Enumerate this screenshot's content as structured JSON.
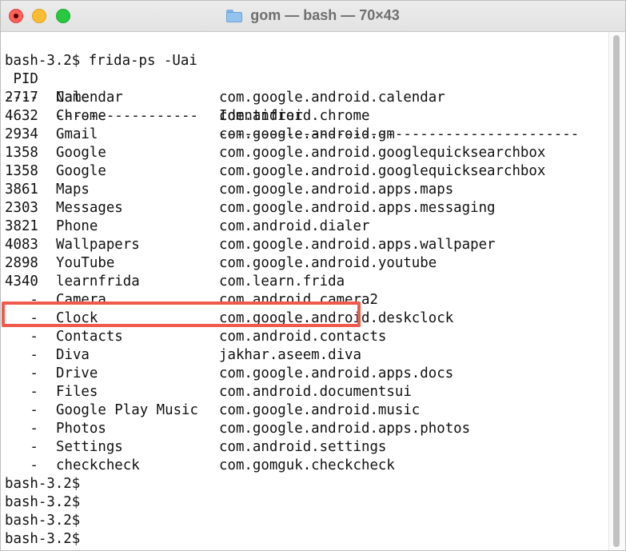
{
  "window": {
    "title": "gom — bash — 70×43",
    "folder_icon": "folder-icon"
  },
  "terminal": {
    "command_line": "bash-3.2$ frida-ps -Uai",
    "header": {
      "pid": " PID",
      "name": "Name",
      "identifier": "Identifier"
    },
    "separator": {
      "pid": "----",
      "name": "-----------------",
      "identifier": "-------------------------------------------"
    },
    "processes": [
      {
        "pid": "2717",
        "name": "Calendar",
        "identifier": "com.google.android.calendar"
      },
      {
        "pid": "4632",
        "name": "Chrome",
        "identifier": "com.android.chrome"
      },
      {
        "pid": "2934",
        "name": "Gmail",
        "identifier": "com.google.android.gm"
      },
      {
        "pid": "1358",
        "name": "Google",
        "identifier": "com.google.android.googlequicksearchbox"
      },
      {
        "pid": "1358",
        "name": "Google",
        "identifier": "com.google.android.googlequicksearchbox"
      },
      {
        "pid": "3861",
        "name": "Maps",
        "identifier": "com.google.android.apps.maps"
      },
      {
        "pid": "2303",
        "name": "Messages",
        "identifier": "com.google.android.apps.messaging"
      },
      {
        "pid": "3821",
        "name": "Phone",
        "identifier": "com.android.dialer"
      },
      {
        "pid": "4083",
        "name": "Wallpapers",
        "identifier": "com.google.android.apps.wallpaper"
      },
      {
        "pid": "2898",
        "name": "YouTube",
        "identifier": "com.google.android.youtube"
      },
      {
        "pid": "4340",
        "name": "learnfrida",
        "identifier": "com.learn.frida"
      },
      {
        "pid": "   -",
        "name": "Camera",
        "identifier": "com.android.camera2"
      },
      {
        "pid": "   -",
        "name": "Clock",
        "identifier": "com.google.android.deskclock"
      },
      {
        "pid": "   -",
        "name": "Contacts",
        "identifier": "com.android.contacts"
      },
      {
        "pid": "   -",
        "name": "Diva",
        "identifier": "jakhar.aseem.diva"
      },
      {
        "pid": "   -",
        "name": "Drive",
        "identifier": "com.google.android.apps.docs"
      },
      {
        "pid": "   -",
        "name": "Files",
        "identifier": "com.android.documentsui"
      },
      {
        "pid": "   -",
        "name": "Google Play Music",
        "identifier": "com.google.android.music"
      },
      {
        "pid": "   -",
        "name": "Photos",
        "identifier": "com.google.android.apps.photos"
      },
      {
        "pid": "   -",
        "name": "Settings",
        "identifier": "com.android.settings"
      },
      {
        "pid": "   -",
        "name": "checkcheck",
        "identifier": "com.gomguk.checkcheck"
      }
    ],
    "prompts": [
      "bash-3.2$",
      "bash-3.2$",
      "bash-3.2$",
      "bash-3.2$"
    ],
    "highlight_color": "#f05a4a"
  }
}
